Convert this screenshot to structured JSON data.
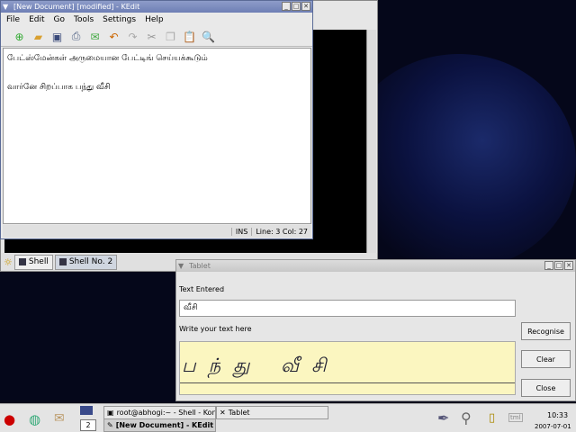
{
  "konsole": {
    "tabs": [
      {
        "label": "Shell"
      },
      {
        "label": "Shell No. 2"
      }
    ]
  },
  "kedit": {
    "title": "[New Document] [modified] - KEdit",
    "menu": [
      "File",
      "Edit",
      "Go",
      "Tools",
      "Settings",
      "Help"
    ],
    "toolbar_icons": [
      "new-icon",
      "open-icon",
      "save-icon",
      "print-icon",
      "mail-icon",
      "undo-icon",
      "redo-icon",
      "cut-icon",
      "copy-icon",
      "paste-icon",
      "find-icon"
    ],
    "lines": [
      "பேட்ஸ்மேன்கள் அருமையான பேட்டிங் செய்யக்கூடும்",
      "",
      "வார்னே சிறப்பாக பந்து வீசி"
    ],
    "status": {
      "mode": "INS",
      "position": "Line: 3 Col: 27"
    }
  },
  "tablet": {
    "title": "Tablet",
    "text_entered_label": "Text Entered",
    "text_entered_value": "வீசி",
    "write_label": "Write your text here",
    "handwriting": "பந்து வீசி",
    "buttons": {
      "recognise": "Recognise",
      "clear": "Clear",
      "close": "Close"
    }
  },
  "taskbar": {
    "desktop": "2",
    "tasks": [
      "root@abhogi:~ - Shell - Konsole",
      "Tablet",
      "[New Document] - KEdit"
    ],
    "time": "10:33",
    "date": "2007-07-01"
  }
}
